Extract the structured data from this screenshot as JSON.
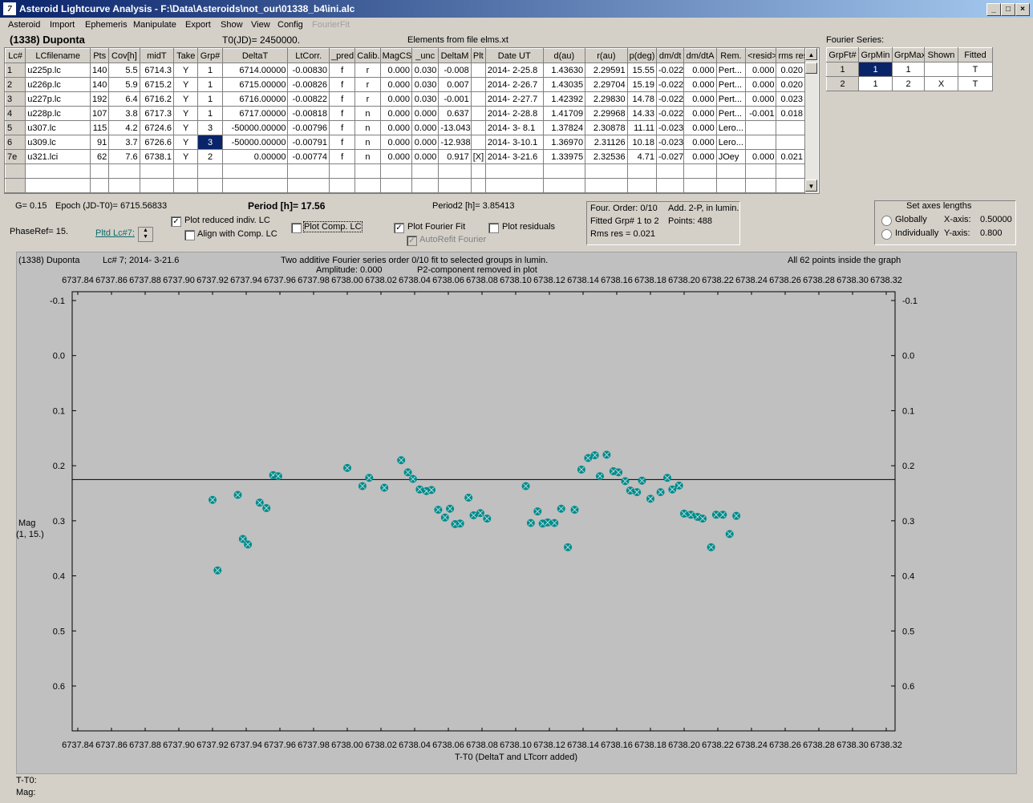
{
  "window": {
    "title": "Asteroid Lightcurve Analysis - F:\\Data\\Asteroids\\not_our\\01338_b4\\ini.alc"
  },
  "menu": [
    "Asteroid",
    "Import",
    "Ephemeris",
    "Manipulate",
    "Export",
    "Show",
    "View",
    "Config",
    "FourierFit"
  ],
  "header": {
    "asteroid": "(1338) Duponta",
    "t0": "T0(JD)= 2450000.",
    "elements": "Elements from file elms.xt",
    "fourier_label": "Fourier Series:"
  },
  "lc_table": {
    "columns": [
      "Lc#",
      "LCfilename",
      "Pts",
      "Cov[h]",
      "midT",
      "Take",
      "Grp#",
      "DeltaT",
      "LtCorr.",
      "_pred.",
      "Calib.",
      "MagCS",
      "_unc",
      "DeltaM",
      "Plt",
      "Date UT",
      "d(au)",
      "r(au)",
      "p(deg)",
      "dm/dt",
      "dm/dtA",
      "Rem.",
      "<resid>",
      "rms res"
    ],
    "rows": [
      [
        "1",
        "u225p.lc",
        "140",
        "5.5",
        "6714.3",
        "Y",
        "1",
        "6714.00000",
        "-0.00830",
        "f",
        "r",
        "0.000",
        "0.030",
        "-0.008",
        "",
        "2014- 2-25.8",
        "1.43630",
        "2.29591",
        "15.55",
        "-0.022",
        "0.000",
        "Pert...",
        "0.000",
        "0.020"
      ],
      [
        "2",
        "u226p.lc",
        "140",
        "5.9",
        "6715.2",
        "Y",
        "1",
        "6715.00000",
        "-0.00826",
        "f",
        "r",
        "0.000",
        "0.030",
        "0.007",
        "",
        "2014- 2-26.7",
        "1.43035",
        "2.29704",
        "15.19",
        "-0.022",
        "0.000",
        "Pert...",
        "0.000",
        "0.020"
      ],
      [
        "3",
        "u227p.lc",
        "192",
        "6.4",
        "6716.2",
        "Y",
        "1",
        "6716.00000",
        "-0.00822",
        "f",
        "r",
        "0.000",
        "0.030",
        "-0.001",
        "",
        "2014- 2-27.7",
        "1.42392",
        "2.29830",
        "14.78",
        "-0.022",
        "0.000",
        "Pert...",
        "0.000",
        "0.023"
      ],
      [
        "4",
        "u228p.lc",
        "107",
        "3.8",
        "6717.3",
        "Y",
        "1",
        "6717.00000",
        "-0.00818",
        "f",
        "n",
        "0.000",
        "0.000",
        "0.637",
        "",
        "2014- 2-28.8",
        "1.41709",
        "2.29968",
        "14.33",
        "-0.022",
        "0.000",
        "Pert...",
        "-0.001",
        "0.018"
      ],
      [
        "5",
        "u307.lc",
        "115",
        "4.2",
        "6724.6",
        "Y",
        "3",
        "-50000.00000",
        "-0.00796",
        "f",
        "n",
        "0.000",
        "0.000",
        "-13.043",
        "",
        "2014- 3- 8.1",
        "1.37824",
        "2.30878",
        "11.11",
        "-0.023",
        "0.000",
        "Lero...",
        "",
        ""
      ],
      [
        "6",
        "u309.lc",
        "91",
        "3.7",
        "6726.6",
        "Y",
        "3",
        "-50000.00000",
        "-0.00791",
        "f",
        "n",
        "0.000",
        "0.000",
        "-12.938",
        "",
        "2014- 3-10.1",
        "1.36970",
        "2.31126",
        "10.18",
        "-0.023",
        "0.000",
        "Lero...",
        "",
        ""
      ],
      [
        "7e",
        "u321.lci",
        "62",
        "7.6",
        "6738.1",
        "Y",
        "2",
        "0.00000",
        "-0.00774",
        "f",
        "n",
        "0.000",
        "0.000",
        "0.917",
        "[X]",
        "2014- 3-21.6",
        "1.33975",
        "2.32536",
        "4.71",
        "-0.027",
        "0.000",
        "JOey",
        "0.000",
        "0.021"
      ]
    ]
  },
  "fourier_table": {
    "columns": [
      "GrpFt#",
      "GrpMin",
      "GrpMax",
      "Shown",
      "Fitted"
    ],
    "rows": [
      [
        "1",
        "1",
        "1",
        "",
        "T"
      ],
      [
        "2",
        "1",
        "2",
        "X",
        "T"
      ]
    ]
  },
  "info": {
    "g": "G= 0.15",
    "epoch": "Epoch (JD-T0)= 6715.56833",
    "period": "Period [h]= 17.56",
    "period2": "Period2 [h]= 3.85413",
    "phaseref": "PhaseRef= 15.",
    "pltd_lc": "Pltd Lc#7:"
  },
  "options": {
    "plot_reduced": "Plot reduced indiv. LC",
    "align_comp": "Align with Comp. LC",
    "plot_comp": "Plot Comp. LC",
    "plot_fourier": "Plot Fourier Fit",
    "autorefit": "AutoRefit Fourier",
    "plot_residuals": "Plot residuals"
  },
  "fit_info": {
    "four_order": "Four. Order:  0/10",
    "add": "Add. 2-P, in lumin.",
    "fitted_grp": "Fitted Grp# 1 to 2",
    "points": "Points: 488",
    "rms": "Rms res     = 0.021"
  },
  "axes_panel": {
    "title": "Set axes lengths",
    "globally": "Globally",
    "individually": "Individually",
    "xaxis_label": "X-axis:",
    "xaxis_val": "0.50000",
    "yaxis_label": "Y-axis:",
    "yaxis_val": "0.800"
  },
  "plot_header": {
    "object": "(1338) Duponta",
    "lc": "Lc# 7; 2014- 3-21.6",
    "line1": "Two additive Fourier series order 0/10 fit to selected groups in lumin.",
    "line2": "Amplitude: 0.000",
    "line3": "P2-component removed in plot",
    "inside": "All 62 points inside the graph",
    "ylabel1": "Mag",
    "ylabel2": "(1, 15.)",
    "xlabel": "T-T0 (DeltaT and LTcorr added)"
  },
  "status": {
    "t_t0": "T-T0:",
    "mag": "Mag:"
  },
  "chart_data": {
    "type": "scatter",
    "xlabel": "T-T0 (DeltaT and LTcorr added)",
    "ylabel": "Mag (1, 15.)",
    "xlim": [
      6737.83,
      6738.33
    ],
    "ylim": [
      0.7,
      -0.15
    ],
    "yreversed": true,
    "x_ticks": [
      "6737.84",
      "6737.86",
      "6737.88",
      "6737.90",
      "6737.92",
      "6737.94",
      "6737.96",
      "6737.98",
      "6738.00",
      "6738.02",
      "6738.04",
      "6738.06",
      "6738.08",
      "6738.10",
      "6738.12",
      "6738.14",
      "6738.16",
      "6738.18",
      "6738.20",
      "6738.22",
      "6738.24",
      "6738.26",
      "6738.28",
      "6738.30",
      "6738.32"
    ],
    "y_ticks": [
      "-0.1",
      "0.0",
      "0.1",
      "0.2",
      "0.3",
      "0.4",
      "0.5",
      "0.6"
    ],
    "fit_line_mag": 0.225,
    "marker_color": "#008b8b",
    "points": [
      [
        6737.92,
        0.262
      ],
      [
        6737.923,
        0.39
      ],
      [
        6737.935,
        0.253
      ],
      [
        6737.938,
        0.333
      ],
      [
        6737.941,
        0.343
      ],
      [
        6737.948,
        0.267
      ],
      [
        6737.952,
        0.277
      ],
      [
        6737.956,
        0.217
      ],
      [
        6737.959,
        0.219
      ],
      [
        6738.0,
        0.204
      ],
      [
        6738.009,
        0.237
      ],
      [
        6738.013,
        0.222
      ],
      [
        6738.022,
        0.24
      ],
      [
        6738.032,
        0.19
      ],
      [
        6738.036,
        0.212
      ],
      [
        6738.039,
        0.224
      ],
      [
        6738.043,
        0.243
      ],
      [
        6738.047,
        0.246
      ],
      [
        6738.05,
        0.244
      ],
      [
        6738.054,
        0.28
      ],
      [
        6738.058,
        0.294
      ],
      [
        6738.061,
        0.278
      ],
      [
        6738.064,
        0.306
      ],
      [
        6738.067,
        0.305
      ],
      [
        6738.072,
        0.258
      ],
      [
        6738.075,
        0.29
      ],
      [
        6738.079,
        0.286
      ],
      [
        6738.083,
        0.296
      ],
      [
        6738.106,
        0.237
      ],
      [
        6738.109,
        0.304
      ],
      [
        6738.113,
        0.283
      ],
      [
        6738.116,
        0.305
      ],
      [
        6738.119,
        0.303
      ],
      [
        6738.123,
        0.304
      ],
      [
        6738.127,
        0.278
      ],
      [
        6738.131,
        0.348
      ],
      [
        6738.135,
        0.28
      ],
      [
        6738.139,
        0.207
      ],
      [
        6738.143,
        0.186
      ],
      [
        6738.147,
        0.181
      ],
      [
        6738.15,
        0.219
      ],
      [
        6738.154,
        0.18
      ],
      [
        6738.158,
        0.21
      ],
      [
        6738.161,
        0.212
      ],
      [
        6738.165,
        0.228
      ],
      [
        6738.168,
        0.245
      ],
      [
        6738.172,
        0.248
      ],
      [
        6738.175,
        0.227
      ],
      [
        6738.18,
        0.26
      ],
      [
        6738.186,
        0.248
      ],
      [
        6738.19,
        0.222
      ],
      [
        6738.193,
        0.243
      ],
      [
        6738.197,
        0.236
      ],
      [
        6738.2,
        0.287
      ],
      [
        6738.204,
        0.289
      ],
      [
        6738.208,
        0.293
      ],
      [
        6738.211,
        0.296
      ],
      [
        6738.216,
        0.348
      ],
      [
        6738.219,
        0.289
      ],
      [
        6738.223,
        0.289
      ],
      [
        6738.227,
        0.324
      ],
      [
        6738.231,
        0.291
      ]
    ]
  }
}
